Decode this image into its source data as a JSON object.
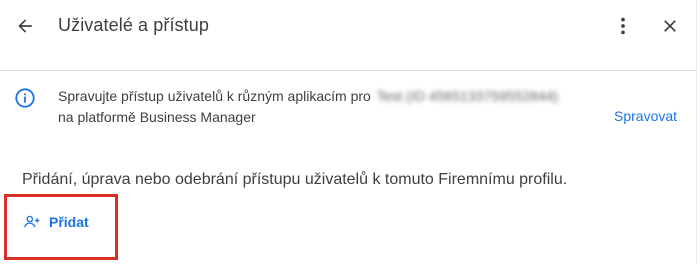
{
  "header": {
    "title": "Uživatelé a přístup",
    "back_icon": "arrow-back-icon",
    "more_icon": "more-vert-icon",
    "close_icon": "close-icon"
  },
  "info_banner": {
    "icon": "info-icon",
    "text_line1": "Spravujte přístup uživatelů k různým aplikacím pro",
    "redacted": "Test (ID 4565133759552844)",
    "text_line2": "na platformě Business Manager",
    "manage_label": "Spravovat"
  },
  "main": {
    "description": "Přidání, úprava nebo odebrání přístupu uživatelů k tomuto Firemnímu profilu.",
    "add_button_label": "Přidat",
    "add_icon": "person-add-icon"
  },
  "colors": {
    "accent": "#1a73e8",
    "highlight": "#d93025",
    "divider": "#dadce0"
  }
}
